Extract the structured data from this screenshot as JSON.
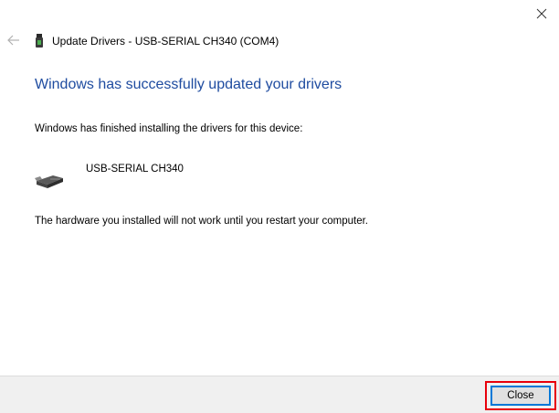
{
  "dialog": {
    "title": "Update Drivers - USB-SERIAL CH340 (COM4)",
    "headline": "Windows has successfully updated your drivers",
    "finished_message": "Windows has finished installing the drivers for this device:",
    "device_name": "USB-SERIAL CH340",
    "restart_message": "The hardware you installed will not work until you restart your computer.",
    "headline_color": "#1f4ca0"
  },
  "footer": {
    "close_label": "Close",
    "highlight_color": "#e8000b"
  },
  "icons": {
    "window_close": "close-icon",
    "back": "back-arrow-icon",
    "title": "usb-device-icon",
    "device": "serial-cable-icon"
  }
}
